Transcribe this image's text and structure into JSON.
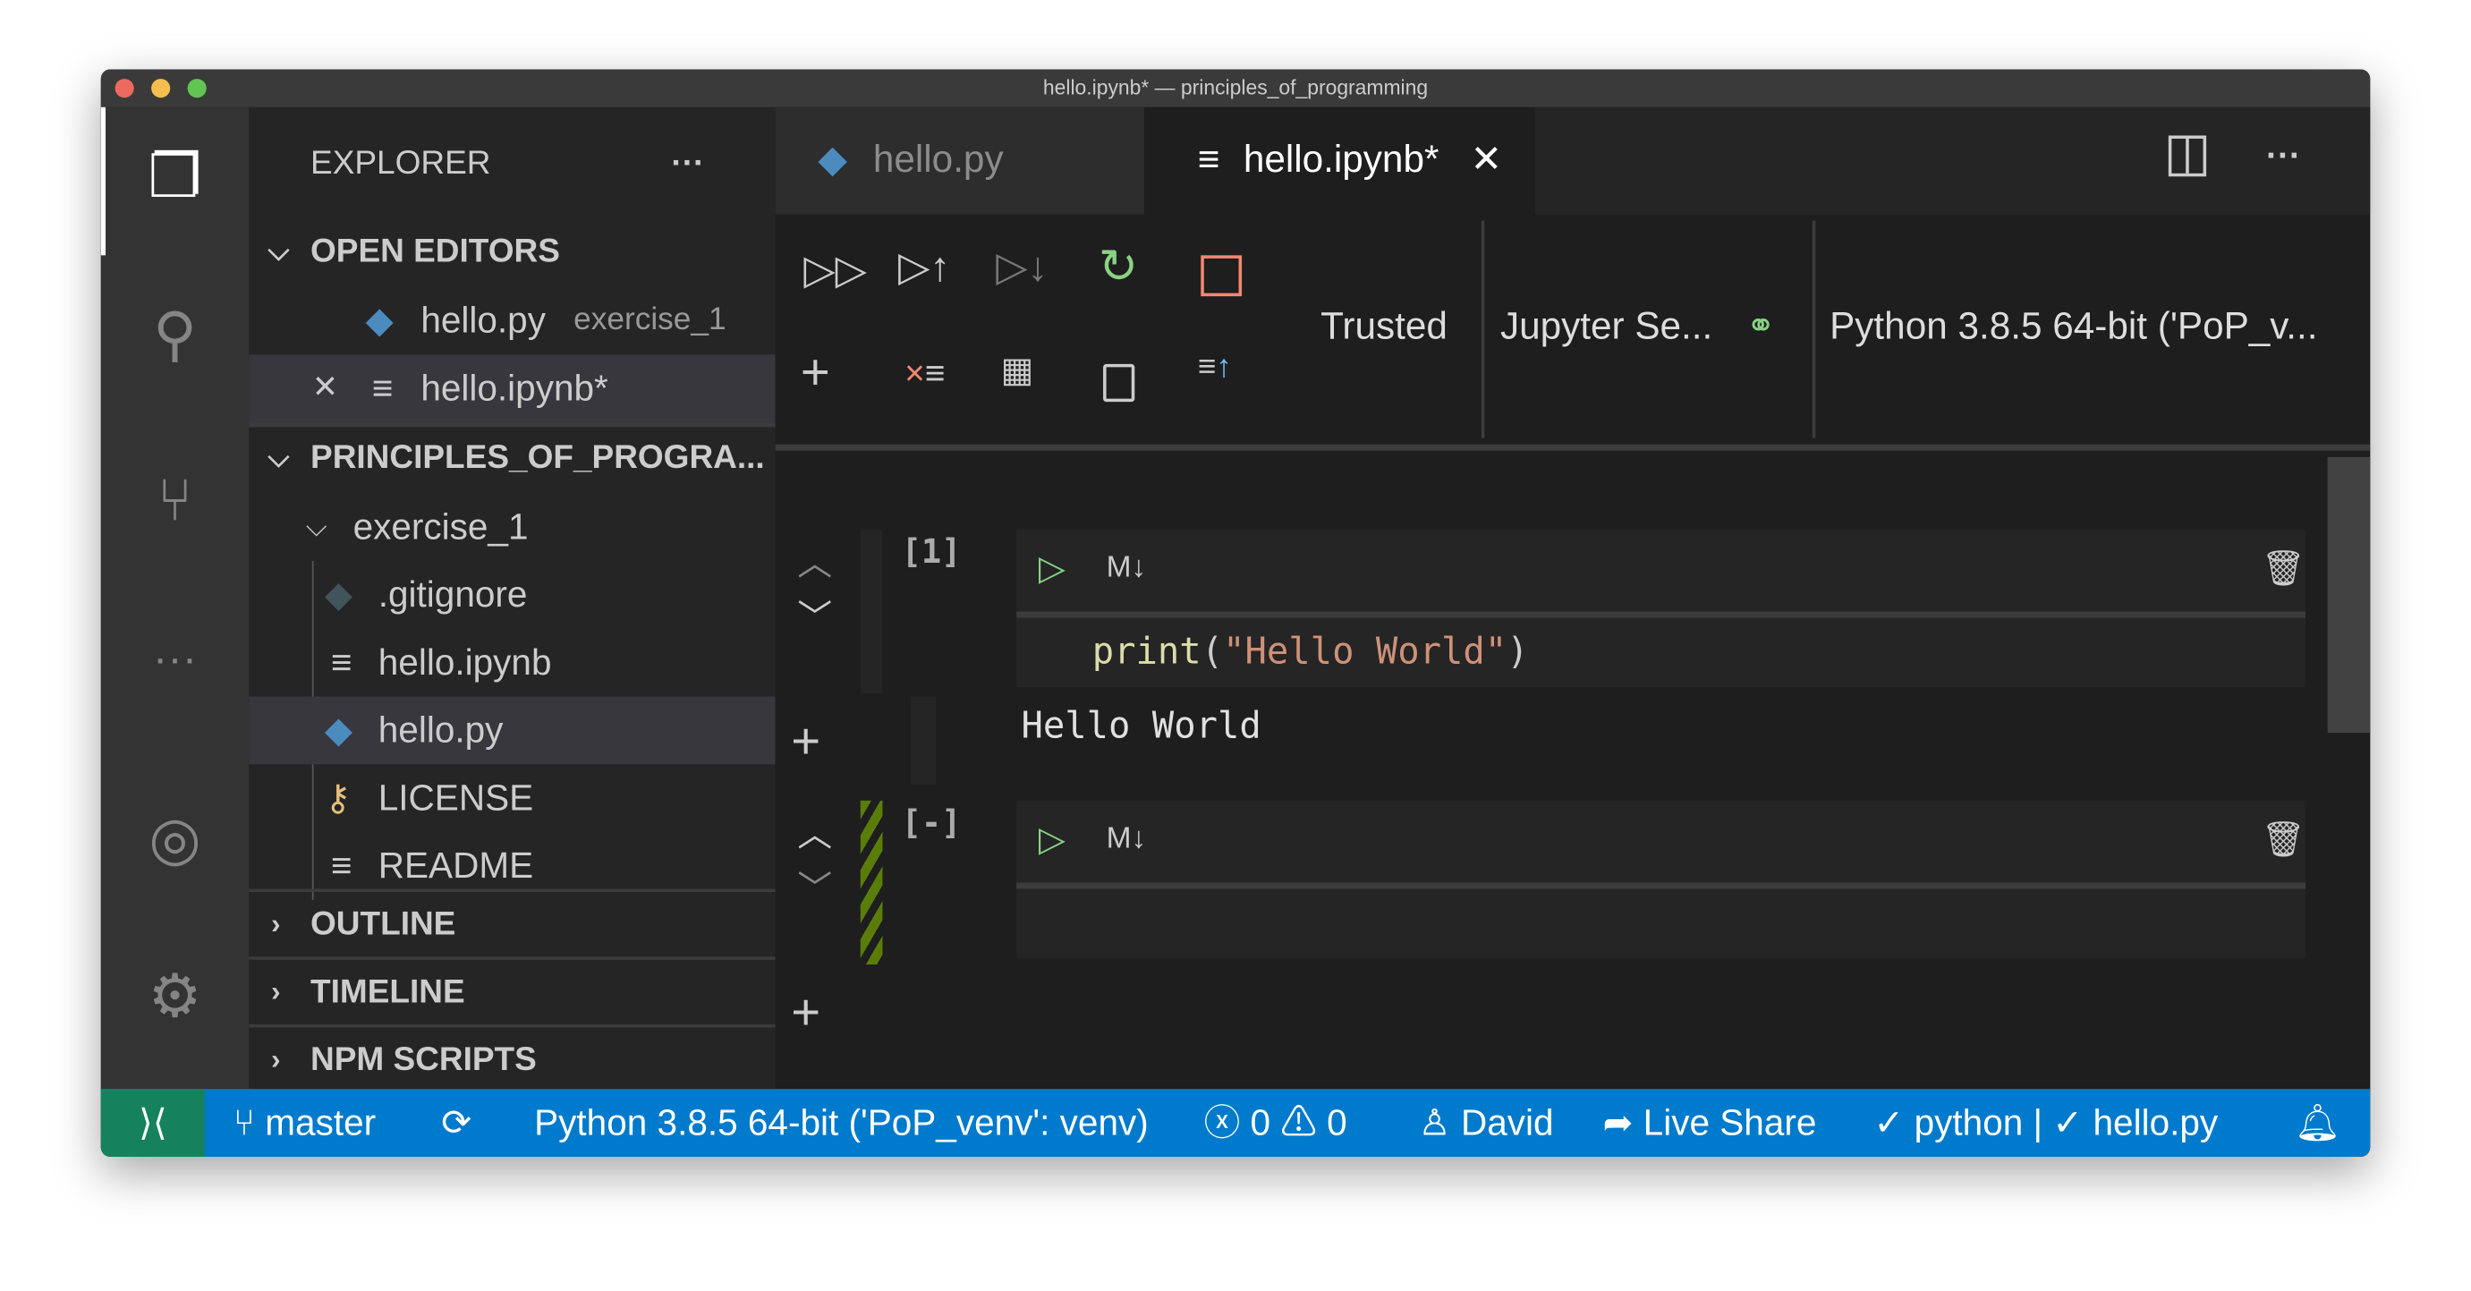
{
  "window": {
    "title": "hello.ipynb* — principles_of_programming"
  },
  "sidebar": {
    "title": "EXPLORER",
    "more": "···",
    "open_editors": {
      "label": "OPEN EDITORS",
      "items": [
        {
          "name": "hello.py",
          "folder": "exercise_1",
          "icon": "python-icon"
        },
        {
          "name": "hello.ipynb*",
          "icon": "notebook-icon",
          "close": "✕"
        }
      ]
    },
    "project": {
      "label": "PRINCIPLES_OF_PROGRA...",
      "folder": "exercise_1",
      "files": [
        {
          "name": ".gitignore",
          "icon": "git-icon"
        },
        {
          "name": "hello.ipynb",
          "icon": "notebook-icon"
        },
        {
          "name": "hello.py",
          "icon": "python-icon"
        },
        {
          "name": "LICENSE",
          "icon": "license-key-icon"
        },
        {
          "name": "README",
          "icon": "readme-icon"
        }
      ]
    },
    "sections": [
      "OUTLINE",
      "TIMELINE",
      "NPM SCRIPTS"
    ]
  },
  "tabs": [
    {
      "label": "hello.py",
      "active": false
    },
    {
      "label": "hello.ipynb*",
      "active": true,
      "close": "✕"
    }
  ],
  "toolbar": {
    "trusted": "Trusted",
    "server": "Jupyter Se...",
    "kernel": "Python 3.8.5 64-bit ('PoP_v..."
  },
  "cells": [
    {
      "count": "[1]",
      "type_label": "M↓",
      "code_fn": "print",
      "code_open": "(",
      "code_str": "\"Hello World\"",
      "code_close": ")",
      "output": "Hello World"
    },
    {
      "count": "[-]",
      "type_label": "M↓",
      "code": ""
    }
  ],
  "status": {
    "branch": "master",
    "interpreter": "Python 3.8.5 64-bit ('PoP_venv': venv)",
    "errors": "0",
    "warnings": "0",
    "user": "David",
    "live_share": "Live Share",
    "checks": "✓ python | ✓ hello.py"
  },
  "colors": {
    "status_bar": "#007acc",
    "remote": "#16825d",
    "run": "#89d185",
    "stop": "#f48771",
    "string": "#ce9178",
    "function": "#dcdcaa"
  }
}
